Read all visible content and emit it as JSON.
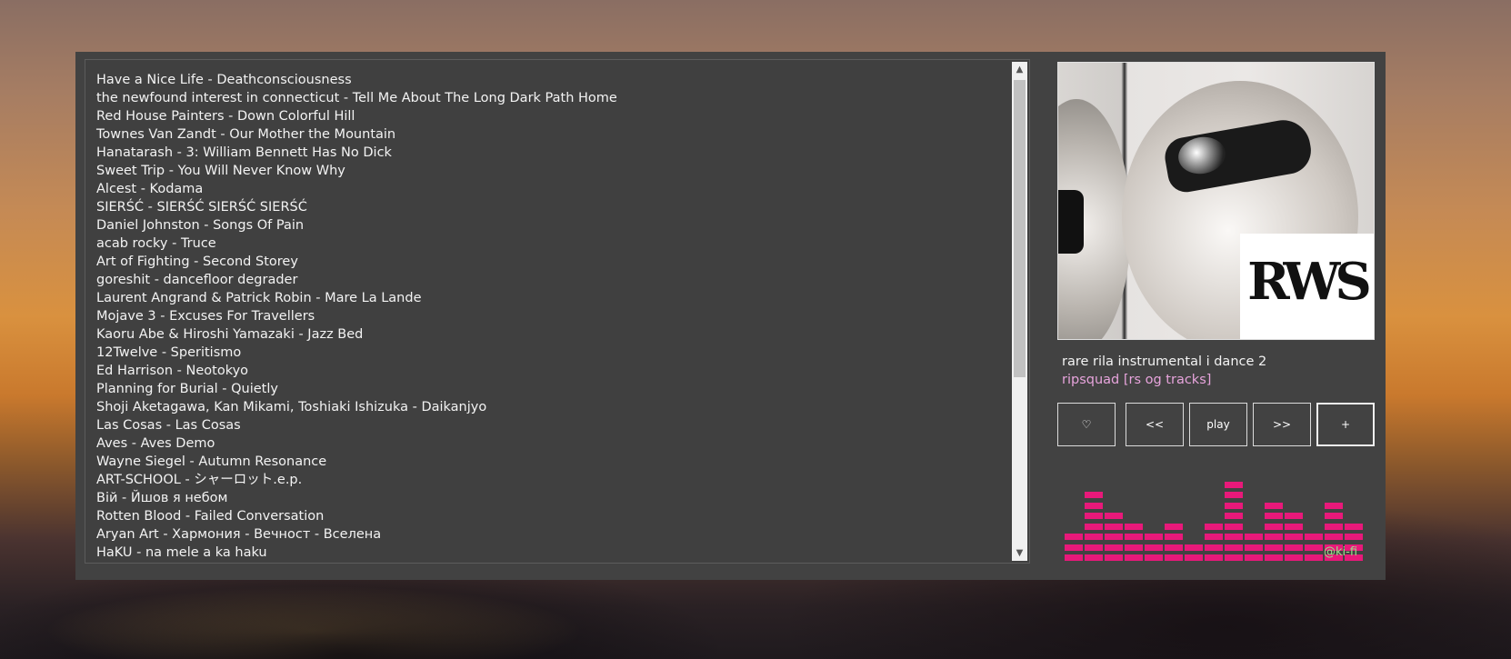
{
  "playlist": {
    "tracks": [
      "Have a Nice Life - Deathconsciousness",
      "the newfound interest in connecticut - Tell Me About The Long Dark Path Home",
      "Red House Painters - Down Colorful Hill",
      "Townes Van Zandt - Our Mother the Mountain",
      "Hanatarash - 3: William Bennett Has No Dick",
      "Sweet Trip - You Will Never Know Why",
      "Alcest - Kodama",
      "SIERŚĆ - SIERŚĆ SIERŚĆ SIERŚĆ",
      "Daniel Johnston - Songs Of Pain",
      "acab rocky - Truce",
      "Art of Fighting - Second Storey",
      "goreshit - dancefloor degrader",
      "Laurent Angrand & Patrick Robin - Mare La Lande",
      "Mojave 3 - Excuses For Travellers",
      "Kaoru Abe & Hiroshi Yamazaki - Jazz Bed",
      "12Twelve - Speritismo",
      "Ed Harrison - Neotokyo",
      "Planning for Burial - Quietly",
      "Shoji Aketagawa, Kan Mikami, Toshiaki Ishizuka - Daikanjyo",
      "Las Cosas - Las Cosas",
      "Aves - Aves Demo",
      "Wayne Siegel - Autumn Resonance",
      "ART-SCHOOL - シャーロット.e.p.",
      "Вій - Йшов я небом",
      "Rotten Blood - Failed Conversation",
      "Aryan Art - Хармония - Вечност - Вселена",
      "HaKU - na mele a ka haku"
    ],
    "scroll_position": 0.0
  },
  "now_playing": {
    "title": "rare rila instrumental i dance 2",
    "artist": "ripsquad [rs og tracks]",
    "art_logo_text": "RWS"
  },
  "controls": {
    "like": "♡",
    "prev": "<<",
    "play": "play",
    "next": ">>",
    "add": "+"
  },
  "visualizer": {
    "levels": [
      3,
      7,
      5,
      4,
      3,
      4,
      2,
      4,
      8,
      3,
      6,
      5,
      3,
      6,
      4
    ],
    "color": "#e8197a"
  },
  "watermark": "@ki-fi",
  "colors": {
    "panel": "#424242",
    "artist_text": "#e7a4dc",
    "watermark_text": "#9be28b"
  },
  "icons": {
    "scroll_up": "triangle-up-icon",
    "scroll_down": "triangle-down-icon"
  }
}
